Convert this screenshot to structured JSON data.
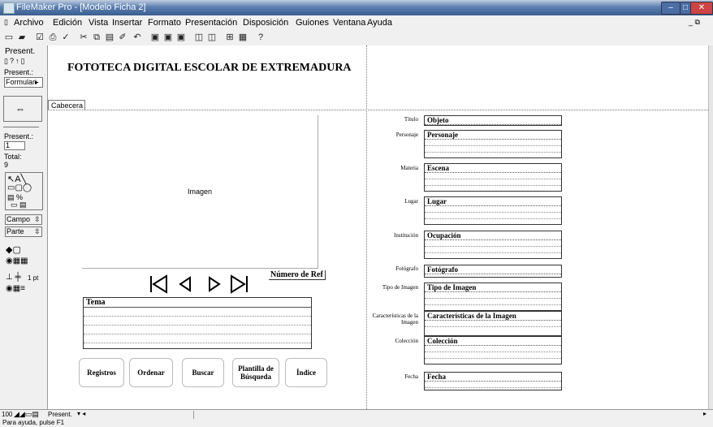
{
  "window": {
    "title": "FileMaker Pro - [Modelo Ficha 2]"
  },
  "menubar": {
    "items": [
      "Archivo",
      "Edición",
      "Vista",
      "Insertar",
      "Formato",
      "Presentación",
      "Disposición",
      "Guiones",
      "Ventana",
      "Ayuda"
    ]
  },
  "status": {
    "mode_label": "Present.",
    "present_label": "Present.:",
    "layout_select": "Formulari",
    "record_label": "Present.:",
    "record_value": "1",
    "total_label": "Total:",
    "total_value": "9",
    "campo": "Campo",
    "parte": "Parte",
    "line_width": "1 pt"
  },
  "layout": {
    "header_title": "FOTOTECA DIGITAL ESCOLAR DE EXTREMADURA",
    "part_label": "Cabecera",
    "image_label": "Imagen",
    "ref_number": "Número de Ref",
    "tema": "Tema",
    "buttons": {
      "registros": "Registros",
      "ordenar": "Ordenar",
      "buscar": "Buscar",
      "plantilla": "Plantilla de Búsqueda",
      "indice": "Índice"
    },
    "fields": [
      {
        "label": "Título",
        "name": "Objeto"
      },
      {
        "label": "Personaje",
        "name": "Personaje"
      },
      {
        "label": "Materia",
        "name": "Escena"
      },
      {
        "label": "Lugar",
        "name": "Lugar"
      },
      {
        "label": "Institución",
        "name": "Ocupación"
      },
      {
        "label": "Fotógrafo",
        "name": "Fotógrafo"
      },
      {
        "label": "Tipo de Imagen",
        "name": "Tipo de Imagen"
      },
      {
        "label": "Características de la Imagen",
        "name": "Características de la Imagen"
      },
      {
        "label": "Colección",
        "name": "Colección"
      },
      {
        "label": "Fecha",
        "name": "Fecha"
      }
    ]
  },
  "bottom": {
    "zoom": "100",
    "mode": "Present."
  },
  "help": {
    "text": "Para ayuda, pulse F1"
  }
}
